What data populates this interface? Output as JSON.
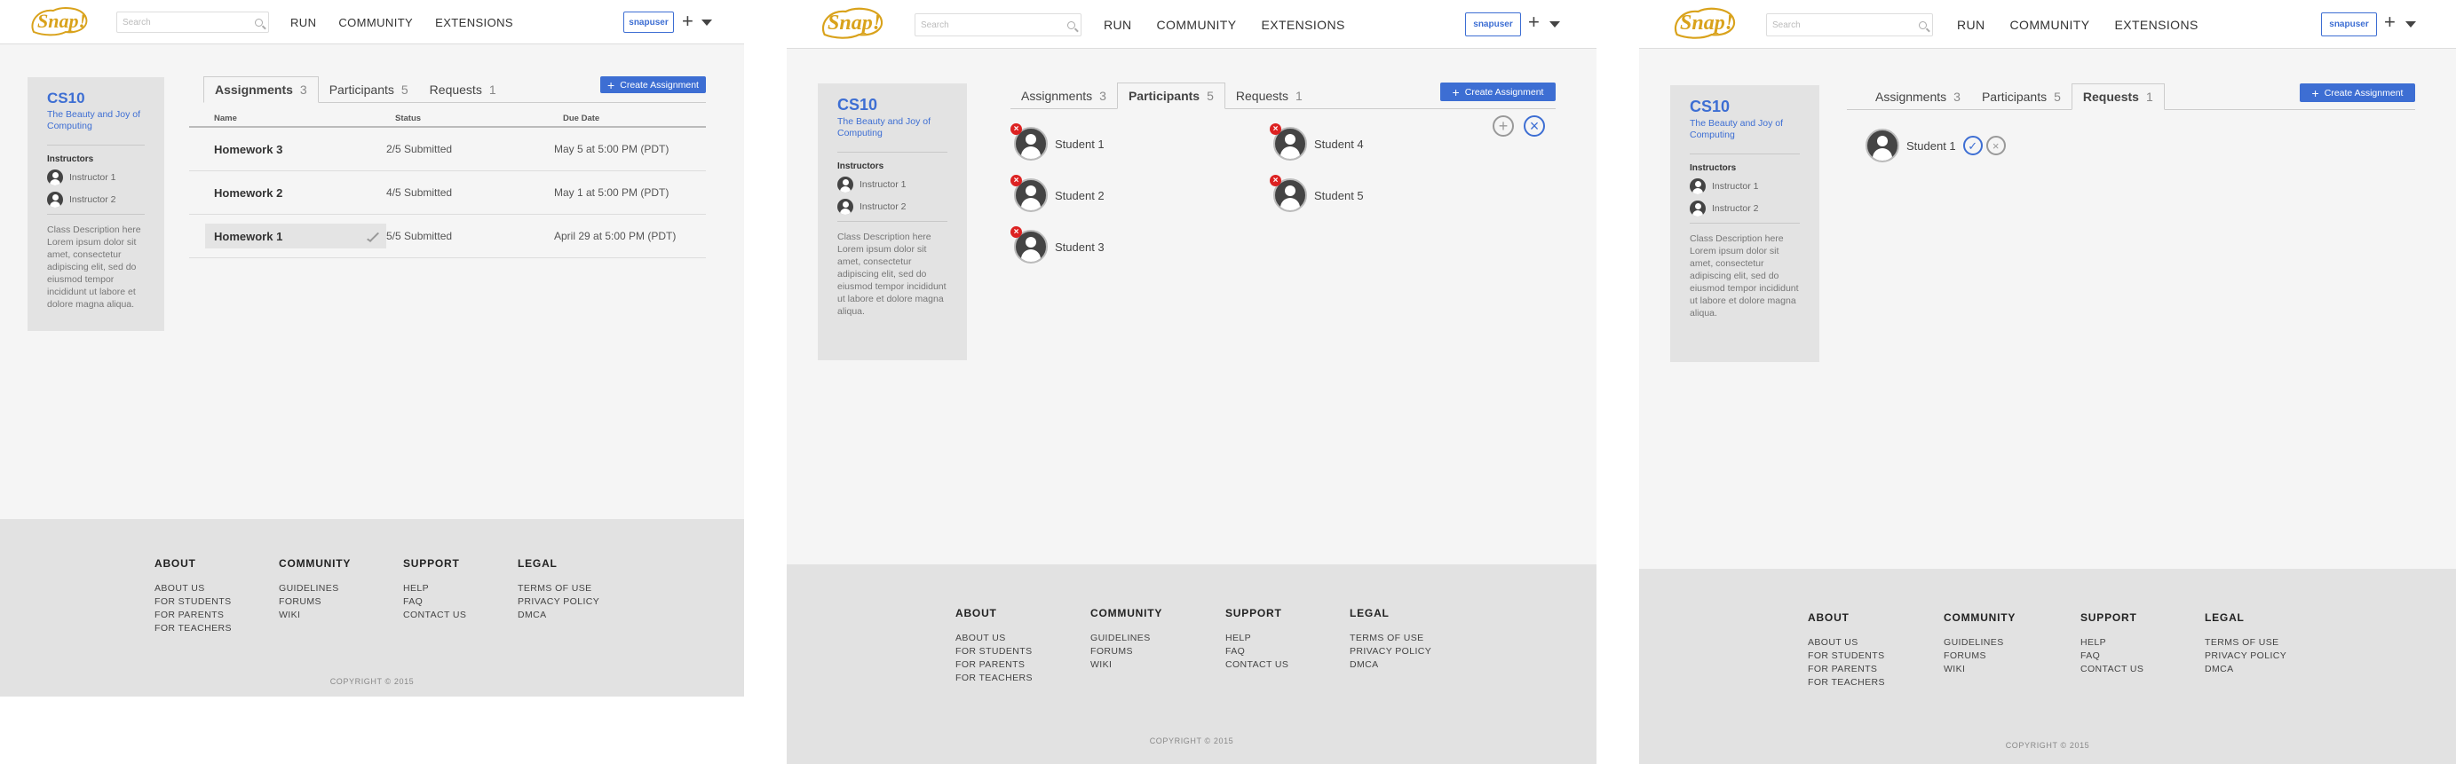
{
  "header": {
    "logo_text": "Snap!",
    "search_placeholder": "Search",
    "nav": [
      "RUN",
      "COMMUNITY",
      "EXTENSIONS"
    ],
    "username": "snapuser"
  },
  "course": {
    "code": "CS10",
    "title": "The Beauty and Joy of Computing",
    "instructors_heading": "Instructors",
    "instructors": [
      "Instructor 1",
      "Instructor 2"
    ],
    "description": "Class Description here Lorem ipsum dolor sit amet, consectetur adipiscing elit, sed do eiusmod tempor incididunt ut labore et dolore magna aliqua."
  },
  "tabs": [
    {
      "label": "Assignments",
      "count": "3"
    },
    {
      "label": "Participants",
      "count": "5"
    },
    {
      "label": "Requests",
      "count": "1"
    }
  ],
  "create_button": "Create Assignment",
  "assignments_table": {
    "columns": [
      "Name",
      "Status",
      "Due Date"
    ],
    "rows": [
      {
        "name": "Homework 3",
        "status": "2/5 Submitted",
        "due": "May 5 at 5:00 PM (PDT)"
      },
      {
        "name": "Homework 2",
        "status": "4/5 Submitted",
        "due": "May 1 at 5:00 PM (PDT)"
      },
      {
        "name": "Homework 1",
        "status": "5/5 Submitted",
        "due": "April 29 at 5:00 PM (PDT)"
      }
    ]
  },
  "participants": [
    "Student 1",
    "Student 2",
    "Student 3",
    "Student 4",
    "Student 5"
  ],
  "requests": [
    "Student 1"
  ],
  "footer": {
    "columns": [
      {
        "heading": "ABOUT",
        "links": [
          "ABOUT US",
          "FOR STUDENTS",
          "FOR PARENTS",
          "FOR TEACHERS"
        ]
      },
      {
        "heading": "COMMUNITY",
        "links": [
          "GUIDELINES",
          "FORUMS",
          "WIKI"
        ]
      },
      {
        "heading": "SUPPORT",
        "links": [
          "HELP",
          "FAQ",
          "CONTACT US"
        ]
      },
      {
        "heading": "LEGAL",
        "links": [
          "TERMS OF USE",
          "PRIVACY POLICY",
          "DMCA"
        ]
      }
    ],
    "copyright": "COPYRIGHT © 2015"
  },
  "colors": {
    "accent": "#3d6ed3",
    "logo": "#d9a21b",
    "remove": "#dd2222"
  }
}
